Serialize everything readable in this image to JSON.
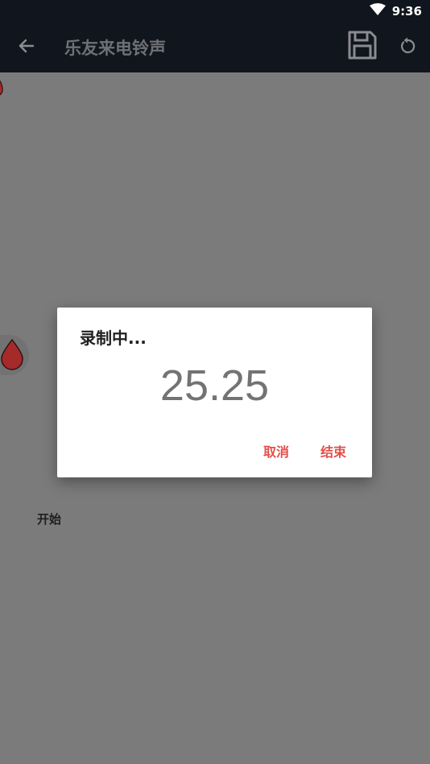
{
  "status_bar": {
    "time": "9:36"
  },
  "app_bar": {
    "title": "乐友来电铃声"
  },
  "content": {
    "start_label": "开始"
  },
  "dialog": {
    "title": "录制中...",
    "timer": "25.25",
    "cancel_label": "取消",
    "finish_label": "结束"
  },
  "colors": {
    "app_bar_bg": "#11151d",
    "overlay": "#7b7b7b",
    "accent": "#e0504a",
    "drop": "#a52a2a"
  },
  "icons": [
    "wifi-icon",
    "back-arrow-icon",
    "save-icon",
    "reset-icon",
    "drop-icon"
  ]
}
